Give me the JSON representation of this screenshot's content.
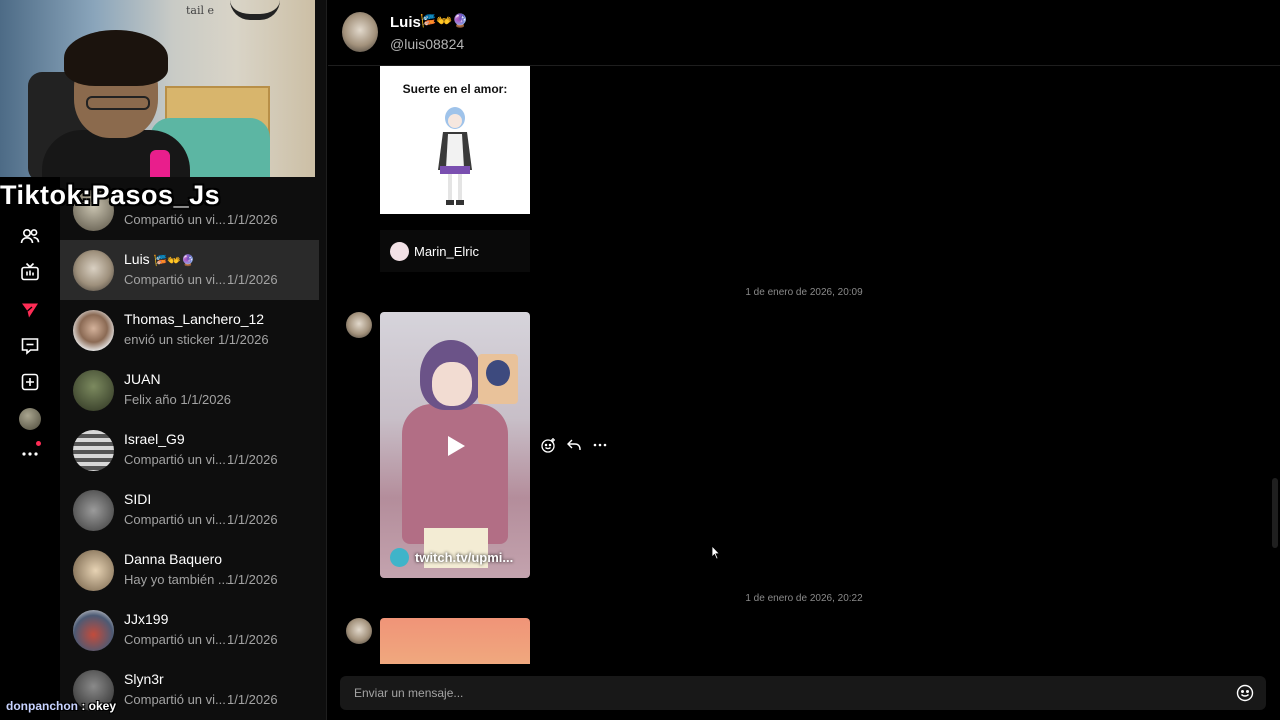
{
  "overlay": {
    "stream_tag": "Tiktok:Pasos_Js",
    "chat_user": "donpanchon",
    "chat_sep": " : ",
    "chat_text": "okey",
    "wall_text": "tail e"
  },
  "rail": {
    "icons": [
      "friends-icon",
      "live-icon",
      "explore-icon",
      "messages-icon",
      "upload-icon",
      "profile-icon",
      "more-icon"
    ],
    "accent": "#fe2c55"
  },
  "conversations": [
    {
      "name": "",
      "preview": "Compartió un vi...",
      "date": "1/1/2026",
      "active": false
    },
    {
      "name": "Luis",
      "emoji": "🎏👐🔮",
      "preview": "Compartió un vi...",
      "date": "1/1/2026",
      "active": true
    },
    {
      "name": "Thomas_Lanchero_12",
      "preview": "envió un sticker",
      "date": "1/1/2026",
      "active": false
    },
    {
      "name": "JUAN",
      "preview": "Felix año",
      "date": "1/1/2026",
      "active": false
    },
    {
      "name": "Israel_G9",
      "preview": "Compartió un vi...",
      "date": "1/1/2026",
      "active": false
    },
    {
      "name": "SIDI",
      "preview": "Compartió un vi...",
      "date": "1/1/2026",
      "active": false
    },
    {
      "name": "Danna Baquero",
      "preview": "Hay yo también ...",
      "date": "1/1/2026",
      "active": false
    },
    {
      "name": "JJx199",
      "preview": "Compartió un vi...",
      "date": "1/1/2026",
      "active": false
    },
    {
      "name": "Slyn3r",
      "preview": "Compartió un vi...",
      "date": "1/1/2026",
      "active": false
    }
  ],
  "header": {
    "name": "Luis",
    "emoji": "🎏👐🔮",
    "handle": "@luis08824"
  },
  "messages": {
    "card1_title": "Suerte en el amor:",
    "card1_author": "Marin_Elric",
    "timestamp1": "1 de enero de 2026, 20:09",
    "video_source": "twitch.tv/upmi...",
    "timestamp2": "1 de enero de 2026, 20:22"
  },
  "input": {
    "placeholder": "Enviar un mensaje..."
  }
}
